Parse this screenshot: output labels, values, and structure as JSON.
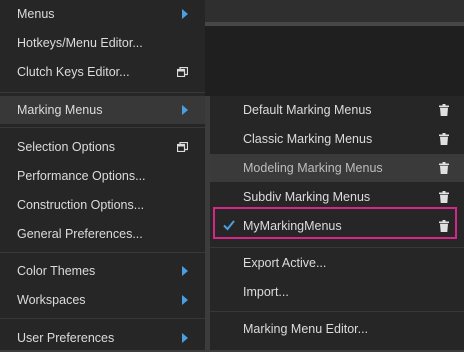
{
  "main_menu": {
    "items": [
      {
        "label": "Menus"
      },
      {
        "label": "Hotkeys/Menu Editor..."
      },
      {
        "label": "Clutch Keys Editor..."
      },
      {
        "label": "Marking Menus"
      },
      {
        "label": "Selection Options"
      },
      {
        "label": "Performance Options..."
      },
      {
        "label": "Construction Options..."
      },
      {
        "label": "General Preferences..."
      },
      {
        "label": "Color Themes"
      },
      {
        "label": "Workspaces"
      },
      {
        "label": "User Preferences"
      }
    ]
  },
  "submenu": {
    "items": [
      {
        "label": "Default Marking Menus"
      },
      {
        "label": "Classic Marking Menus"
      },
      {
        "label": "Modeling Marking Menus"
      },
      {
        "label": "Subdiv Marking Menus"
      },
      {
        "label": "MyMarkingMenus"
      },
      {
        "label": "Export Active..."
      },
      {
        "label": "Import..."
      },
      {
        "label": "Marking Menu Editor..."
      }
    ]
  },
  "colors": {
    "menu_bg": "#262626",
    "accent_arrow": "#4a9fe3",
    "highlight_border": "#d5278a"
  }
}
